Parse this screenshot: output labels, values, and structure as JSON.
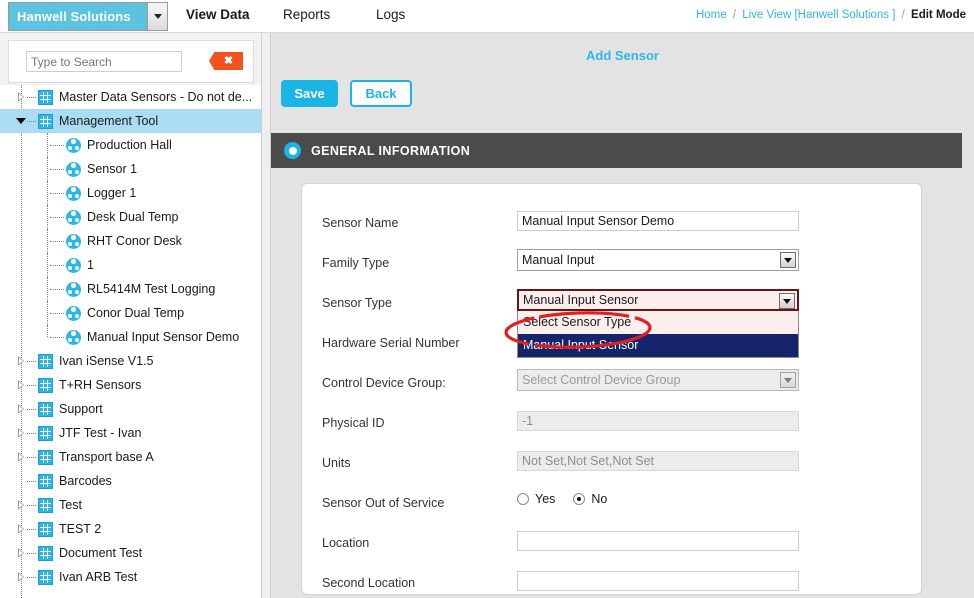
{
  "topbar": {
    "brand": "Hanwell Solutions",
    "brand_caret_icon": "chevron-down-icon",
    "nav": [
      {
        "label": "View Data",
        "active": true
      },
      {
        "label": "Reports",
        "active": false
      },
      {
        "label": "Logs",
        "active": false
      }
    ],
    "breadcrumb": {
      "home": "Home",
      "sep": "/",
      "live_view": "Live View [Hanwell Solutions ]",
      "current": "Edit Mode"
    }
  },
  "sidebar": {
    "search": {
      "placeholder": "Type to Search",
      "value": "",
      "clear_label": "✖",
      "clear_icon": "close-icon"
    },
    "tree": [
      {
        "label": "Master Data Sensors - Do not de...",
        "type": "group",
        "indent": 0,
        "twisty": "closed",
        "selected": false
      },
      {
        "label": "Management Tool",
        "type": "group",
        "indent": 0,
        "twisty": "open",
        "selected": true
      },
      {
        "label": "Production Hall",
        "type": "sensor",
        "indent": 1,
        "twisty": "none",
        "selected": false
      },
      {
        "label": "Sensor 1",
        "type": "sensor",
        "indent": 1,
        "twisty": "none",
        "selected": false
      },
      {
        "label": "Logger 1",
        "type": "sensor",
        "indent": 1,
        "twisty": "none",
        "selected": false
      },
      {
        "label": "Desk Dual Temp",
        "type": "sensor",
        "indent": 1,
        "twisty": "none",
        "selected": false
      },
      {
        "label": "RHT Conor Desk",
        "type": "sensor",
        "indent": 1,
        "twisty": "none",
        "selected": false
      },
      {
        "label": "1",
        "type": "sensor",
        "indent": 1,
        "twisty": "none",
        "selected": false
      },
      {
        "label": "RL5414M Test Logging",
        "type": "sensor",
        "indent": 1,
        "twisty": "none",
        "selected": false
      },
      {
        "label": "Conor Dual Temp",
        "type": "sensor",
        "indent": 1,
        "twisty": "none",
        "selected": false
      },
      {
        "label": "Manual Input Sensor Demo",
        "type": "sensor",
        "indent": 1,
        "twisty": "none",
        "selected": false
      },
      {
        "label": "Ivan iSense V1.5",
        "type": "group",
        "indent": 0,
        "twisty": "closed",
        "selected": false
      },
      {
        "label": "T+RH Sensors",
        "type": "group",
        "indent": 0,
        "twisty": "closed",
        "selected": false
      },
      {
        "label": "Support",
        "type": "group",
        "indent": 0,
        "twisty": "closed",
        "selected": false
      },
      {
        "label": "JTF Test - Ivan",
        "type": "group",
        "indent": 0,
        "twisty": "closed",
        "selected": false
      },
      {
        "label": "Transport base A",
        "type": "group",
        "indent": 0,
        "twisty": "closed",
        "selected": false
      },
      {
        "label": "Barcodes",
        "type": "group",
        "indent": 0,
        "twisty": "none",
        "selected": false
      },
      {
        "label": "Test",
        "type": "group",
        "indent": 0,
        "twisty": "closed",
        "selected": false
      },
      {
        "label": "TEST 2",
        "type": "group",
        "indent": 0,
        "twisty": "closed",
        "selected": false
      },
      {
        "label": "Document Test",
        "type": "group",
        "indent": 0,
        "twisty": "closed",
        "selected": false
      },
      {
        "label": "Ivan ARB Test",
        "type": "group",
        "indent": 0,
        "twisty": "closed",
        "selected": false
      }
    ]
  },
  "main": {
    "page_title": "Add Sensor",
    "save_label": "Save",
    "back_label": "Back",
    "section": {
      "title": "GENERAL INFORMATION",
      "toggle_icon": "collapse-toggle-icon"
    },
    "fields": {
      "sensor_name": {
        "label": "Sensor Name",
        "value": "Manual Input Sensor Demo"
      },
      "family_type": {
        "label": "Family Type",
        "value": "Manual Input"
      },
      "sensor_type": {
        "label": "Sensor Type",
        "value": "Manual Input Sensor",
        "open": true,
        "options": [
          "Select Sensor  Type",
          "Manual Input Sensor"
        ],
        "selected_index": 1
      },
      "hardware_serial_number": {
        "label": "Hardware Serial Number",
        "value": ""
      },
      "control_device_group": {
        "label": "Control Device Group:",
        "value": "Select Control Device Group"
      },
      "physical_id": {
        "label": "Physical ID",
        "value": "-1"
      },
      "units": {
        "label": "Units",
        "value": "Not Set,Not Set,Not Set"
      },
      "out_of_service": {
        "label": "Sensor Out of Service",
        "options": [
          "Yes",
          "No"
        ],
        "selected": "No"
      },
      "location": {
        "label": "Location",
        "value": ""
      },
      "second_location": {
        "label": "Second Location",
        "value": ""
      }
    }
  },
  "colors": {
    "accent": "#19b5e5",
    "brand_bg": "#5bc3e0",
    "section_bg": "#4b4b4b",
    "selected_node": "#aadcf4",
    "dropdown_active": "#16246b",
    "invalid_border": "#6b1414",
    "invalid_bg": "#fdeeee",
    "annotation": "#e02020",
    "clear_btn": "#f4511e"
  }
}
